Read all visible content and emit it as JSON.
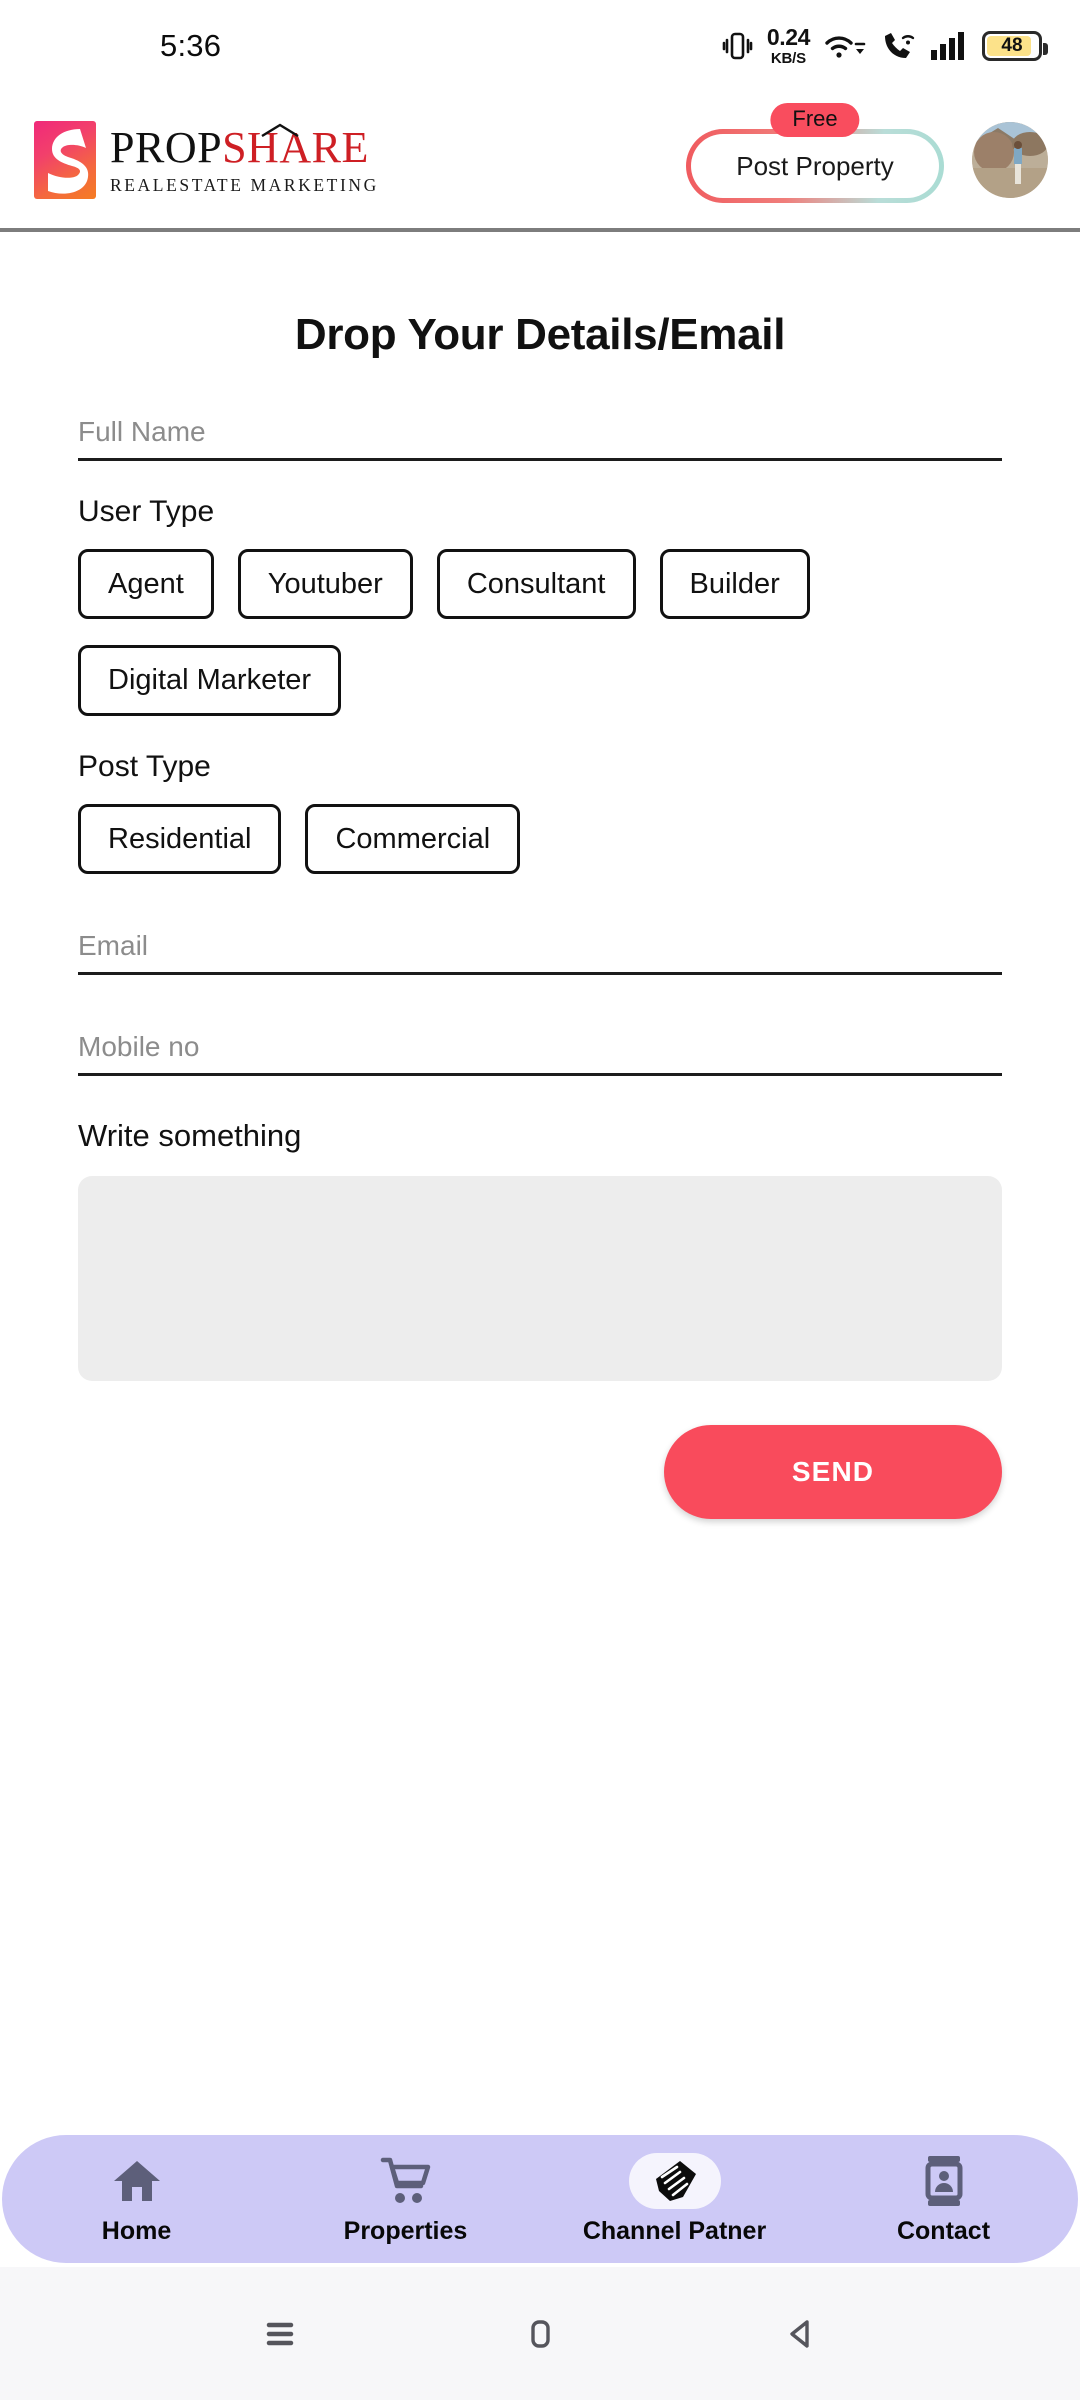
{
  "status_bar": {
    "time": "5:36",
    "network_speed_value": "0.24",
    "network_speed_unit": "KB/S",
    "battery_level": "48",
    "icons": [
      "vibrate-icon",
      "wifi-icon",
      "wifi-calling-icon",
      "cellular-signal-icon",
      "battery-icon"
    ]
  },
  "header": {
    "logo_text_dark": "PROP",
    "logo_text_red": "SHARE",
    "logo_tagline": "REALESTATE MARKETING",
    "post_property_label": "Post Property",
    "free_badge": "Free",
    "avatar_name": "user-avatar"
  },
  "form": {
    "title": "Drop Your Details/Email",
    "full_name_placeholder": "Full Name",
    "full_name_value": "",
    "user_type_label": "User Type",
    "user_types": [
      "Agent",
      "Youtuber",
      "Consultant",
      "Builder",
      "Digital Marketer"
    ],
    "post_type_label": "Post Type",
    "post_types": [
      "Residential",
      "Commercial"
    ],
    "email_placeholder": "Email",
    "email_value": "",
    "mobile_placeholder": "Mobile no",
    "mobile_value": "",
    "message_label": "Write something",
    "message_value": "",
    "send_label": "SEND"
  },
  "bottom_nav": {
    "items": [
      {
        "label": "Home",
        "icon": "home-icon",
        "active": false
      },
      {
        "label": "Properties",
        "icon": "shopping-cart-icon",
        "active": false
      },
      {
        "label": "Channel Patner",
        "icon": "handshake-icon",
        "active": true
      },
      {
        "label": "Contact",
        "icon": "contact-card-icon",
        "active": false
      }
    ]
  },
  "system_nav": {
    "recents": "recents-icon",
    "home": "home-square-icon",
    "back": "back-triangle-icon"
  },
  "colors": {
    "accent_red": "#F94B5C",
    "logo_red": "#CE1F24",
    "nav_lavender": "#CDC9F6",
    "textarea_gray": "#EDEDED",
    "battery_yellow": "#FCE28A"
  }
}
